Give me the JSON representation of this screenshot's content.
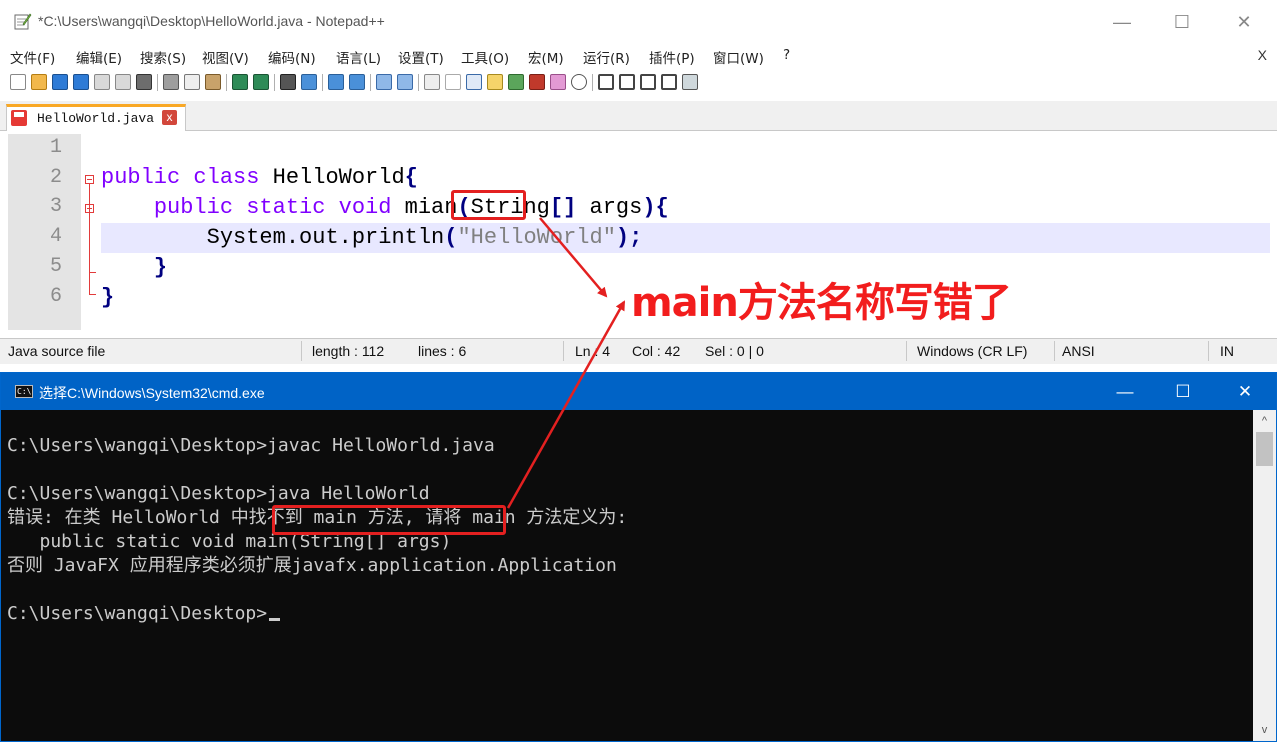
{
  "notepad": {
    "title": "*C:\\Users\\wangqi\\Desktop\\HelloWorld.java - Notepad++",
    "menu": [
      "文件(F)",
      "编辑(E)",
      "搜索(S)",
      "视图(V)",
      "编码(N)",
      "语言(L)",
      "设置(T)",
      "工具(O)",
      "宏(M)",
      "运行(R)",
      "插件(P)",
      "窗口(W)",
      "?"
    ],
    "menu_close": "X",
    "tab_label": "HelloWorld.java",
    "tab_close": "x",
    "line_numbers": [
      "1",
      "2",
      "3",
      "4",
      "5",
      "6"
    ],
    "code": {
      "l2_kw": "public class",
      "l2_name": " HelloWorld",
      "l2_brace": "{",
      "l3_kw": "public static void",
      "l3_method": "mian",
      "l3_paren": "(",
      "l3_params": "String",
      "l3_brackets": "[]",
      "l3_args": " args",
      "l3_close": "){",
      "l4_call": "System.out.println",
      "l4_open": "(",
      "l4_str": "\"HelloWorld\"",
      "l4_close": ");",
      "l5": "}",
      "l6": "}"
    },
    "status": {
      "file_type": "Java source file",
      "length": "length : 112",
      "lines": "lines : 6",
      "ln": "Ln : 4",
      "col": "Col : 42",
      "sel": "Sel : 0 | 0",
      "eol": "Windows (CR LF)",
      "encoding": "ANSI",
      "ins": "IN"
    }
  },
  "cmd": {
    "title": "选择C:\\Windows\\System32\\cmd.exe",
    "icon_text": "C:\\",
    "lines": [
      "C:\\Users\\wangqi\\Desktop>javac HelloWorld.java",
      "C:\\Users\\wangqi\\Desktop>java HelloWorld",
      "错误: 在类 HelloWorld 中找不到 main 方法, 请将 main 方法定义为:",
      "   public static void main(String[] args)",
      "否则 JavaFX 应用程序类必须扩展javafx.application.Application",
      "C:\\Users\\wangqi\\Desktop>"
    ]
  },
  "annotation": {
    "text": "main方法名称写错了",
    "color": "#f21d1d"
  },
  "window_controls": {
    "minimize": "—",
    "maximize": "☐",
    "close": "✕"
  },
  "scroll": {
    "up": "^",
    "down": "v"
  }
}
